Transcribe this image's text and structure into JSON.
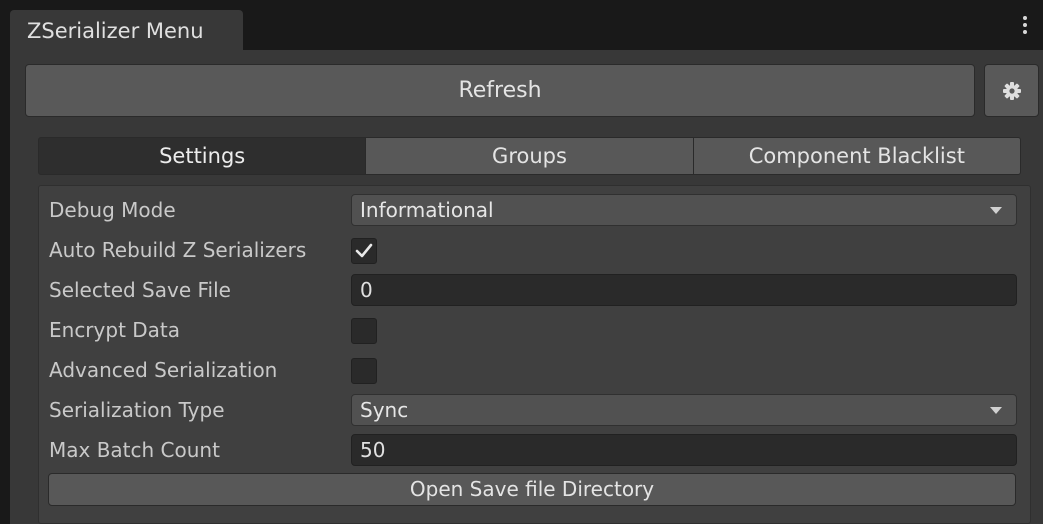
{
  "window": {
    "tab_title": "ZSerializer Menu"
  },
  "toolbar": {
    "refresh_label": "Refresh"
  },
  "tabs": [
    {
      "label": "Settings",
      "active": true
    },
    {
      "label": "Groups",
      "active": false
    },
    {
      "label": "Component Blacklist",
      "active": false
    }
  ],
  "settings": {
    "debug_mode": {
      "label": "Debug Mode",
      "value": "Informational"
    },
    "auto_rebuild": {
      "label": "Auto Rebuild Z Serializers",
      "checked": true
    },
    "selected_save_file": {
      "label": "Selected Save File",
      "value": "0"
    },
    "encrypt_data": {
      "label": "Encrypt Data",
      "checked": false
    },
    "advanced_serialization": {
      "label": "Advanced Serialization",
      "checked": false
    },
    "serialization_type": {
      "label": "Serialization Type",
      "value": "Sync"
    },
    "max_batch_count": {
      "label": "Max Batch Count",
      "value": "50"
    },
    "open_directory_label": "Open Save file Directory"
  },
  "icons": {
    "settings": "gear-icon",
    "window_menu": "kebab-menu-icon",
    "dropdown": "triangle-down-icon",
    "check": "checkmark-icon"
  },
  "colors": {
    "background": "#191919",
    "panel": "#383838",
    "content": "#404040",
    "button": "#585858",
    "active_tab": "#2e2e2e",
    "field": "#2a2a2a"
  }
}
